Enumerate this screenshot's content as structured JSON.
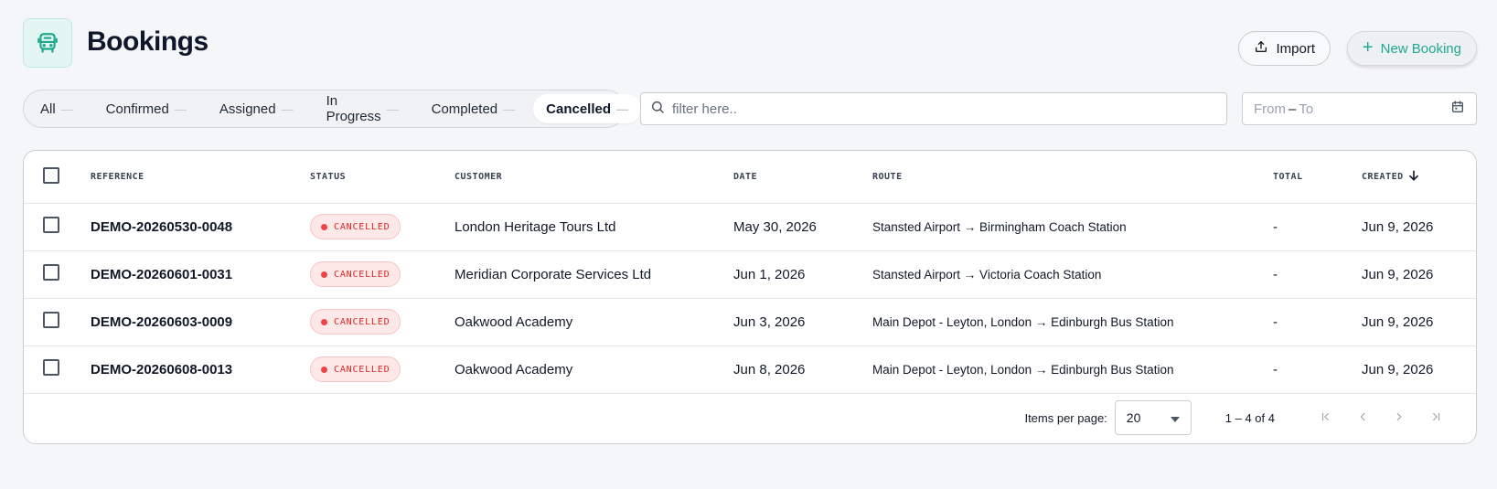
{
  "header": {
    "title": "Bookings",
    "import_label": "Import",
    "new_booking_label": "New Booking"
  },
  "filters": {
    "tabs": [
      {
        "label": "All",
        "count": "—"
      },
      {
        "label": "Confirmed",
        "count": "—"
      },
      {
        "label": "Assigned",
        "count": "—"
      },
      {
        "label": "In Progress",
        "count": "—"
      },
      {
        "label": "Completed",
        "count": "—"
      },
      {
        "label": "Cancelled",
        "count": "—"
      }
    ],
    "active_tab": "Cancelled",
    "search_placeholder": "filter here..",
    "date_from": "From",
    "date_separator": "–",
    "date_to": "To"
  },
  "table": {
    "columns": {
      "reference": "Reference",
      "status": "Status",
      "customer": "Customer",
      "date": "Date",
      "route": "Route",
      "total": "Total",
      "created": "Created"
    },
    "rows": [
      {
        "reference": "DEMO-20260530-0048",
        "status": "CANCELLED",
        "customer": "London Heritage Tours Ltd",
        "date": "May 30, 2026",
        "route": "Stansted Airport → Birmingham Coach Station",
        "total": "-",
        "created": "Jun 9, 2026"
      },
      {
        "reference": "DEMO-20260601-0031",
        "status": "CANCELLED",
        "customer": "Meridian Corporate Services Ltd",
        "date": "Jun 1, 2026",
        "route": "Stansted Airport → Victoria Coach Station",
        "total": "-",
        "created": "Jun 9, 2026"
      },
      {
        "reference": "DEMO-20260603-0009",
        "status": "CANCELLED",
        "customer": "Oakwood Academy",
        "date": "Jun 3, 2026",
        "route": "Main Depot - Leyton, London → Edinburgh Bus Station",
        "total": "-",
        "created": "Jun 9, 2026"
      },
      {
        "reference": "DEMO-20260608-0013",
        "status": "CANCELLED",
        "customer": "Oakwood Academy",
        "date": "Jun 8, 2026",
        "route": "Main Depot - Leyton, London → Edinburgh Bus Station",
        "total": "-",
        "created": "Jun 9, 2026"
      }
    ]
  },
  "paginator": {
    "items_per_page_label": "Items per page:",
    "items_per_page": "20",
    "range_label": "1 – 4 of 4"
  },
  "colors": {
    "accent": "#1fa88d",
    "cancelled": "#dc2626"
  },
  "icons": {
    "app": "bus-icon",
    "import": "upload-icon",
    "new": "plus-icon",
    "search": "search-icon",
    "calendar": "calendar-icon",
    "sort": "arrow-down-icon"
  }
}
